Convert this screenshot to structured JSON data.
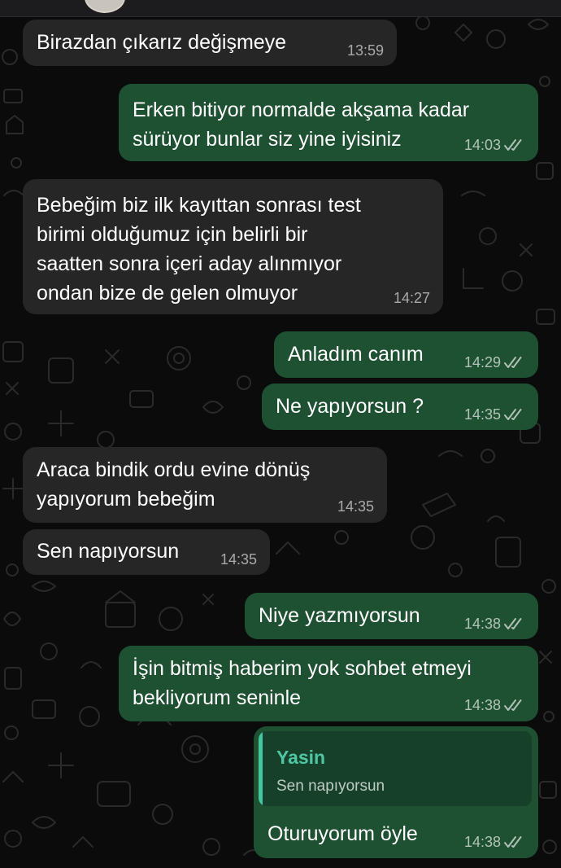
{
  "chat": {
    "messages": [
      {
        "direction": "in",
        "lines": [
          "Birazdan çıkarız değişmeye"
        ],
        "time": "13:59"
      },
      {
        "direction": "out",
        "lines": [
          "Erken bitiyor normalde akşama kadar",
          "sürüyor bunlar siz yine iyisiniz"
        ],
        "time": "14:03",
        "status": "read"
      },
      {
        "direction": "in",
        "lines": [
          "Bebeğim biz ilk kayıttan sonrası test",
          "birimi olduğumuz için belirli bir",
          "saatten sonra içeri aday alınmıyor",
          "ondan bize de gelen olmuyor"
        ],
        "time": "14:27"
      },
      {
        "direction": "out",
        "lines": [
          "Anladım canım"
        ],
        "time": "14:29",
        "status": "read"
      },
      {
        "direction": "out",
        "lines": [
          "Ne yapıyorsun ?"
        ],
        "time": "14:35",
        "status": "read"
      },
      {
        "direction": "in",
        "lines": [
          "Araca bindik ordu evine dönüş",
          "yapıyorum bebeğim"
        ],
        "time": "14:35"
      },
      {
        "direction": "in",
        "lines": [
          "Sen napıyorsun"
        ],
        "time": "14:35"
      },
      {
        "direction": "out",
        "lines": [
          "Niye yazmıyorsun"
        ],
        "time": "14:38",
        "status": "read"
      },
      {
        "direction": "out",
        "lines": [
          "İşin bitmiş haberim yok sohbet etmeyi",
          "bekliyorum seninle"
        ],
        "time": "14:38",
        "status": "read"
      },
      {
        "direction": "out",
        "reply_to": {
          "author": "Yasin",
          "text": "Sen napıyorsun"
        },
        "lines": [
          "Oturuyorum öyle"
        ],
        "time": "14:38",
        "status": "read"
      }
    ]
  },
  "colors": {
    "background": "#0b0b0b",
    "incoming_bubble": "#262626",
    "outgoing_bubble": "#1e5132",
    "reply_accent": "#44c6a0"
  },
  "icons": {
    "read_receipt": "double-check-icon",
    "avatar": "contact-avatar"
  }
}
